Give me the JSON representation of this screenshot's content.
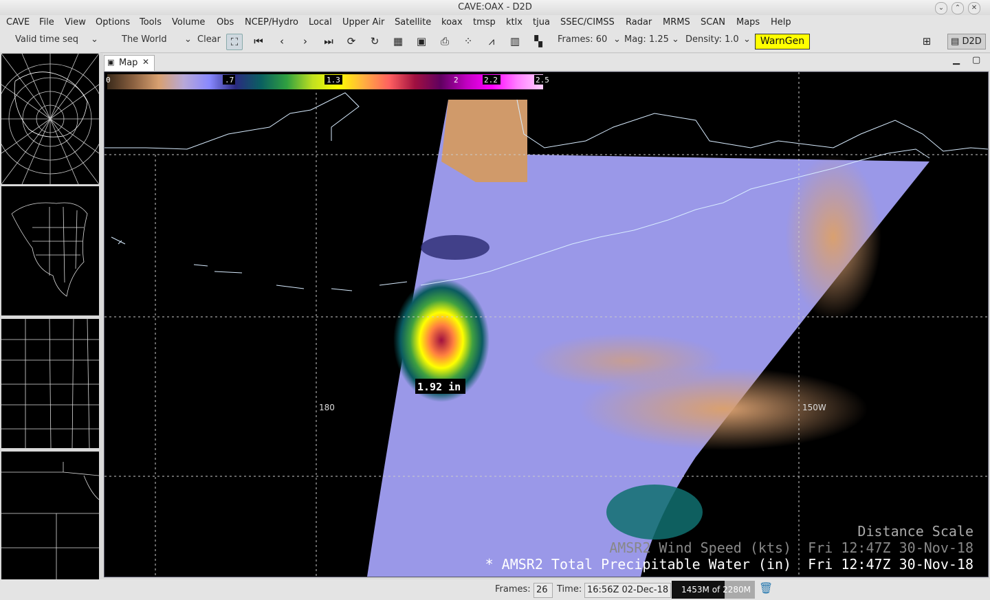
{
  "window": {
    "title": "CAVE:OAX - D2D"
  },
  "menu": [
    "CAVE",
    "File",
    "View",
    "Options",
    "Tools",
    "Volume",
    "Obs",
    "NCEP/Hydro",
    "Local",
    "Upper Air",
    "Satellite",
    "koax",
    "tmsp",
    "ktlx",
    "tjua",
    "SSEC/CIMSS",
    "Radar",
    "MRMS",
    "SCAN",
    "Maps",
    "Help"
  ],
  "toolbar": {
    "time_mode": "Valid time seq",
    "scale": "The World",
    "clear": "Clear",
    "frames": "Frames: 60",
    "mag": "Mag: 1.25",
    "density": "Density: 1.0",
    "warngen": "WarnGen",
    "perspective": "D2D"
  },
  "tab": {
    "label": "Map"
  },
  "colorbar": {
    "ticks": [
      "0",
      ".7",
      "1.3",
      "2",
      "2.2",
      "2.5"
    ],
    "colors": [
      "#3a2a1a",
      "#8a6040",
      "#d8a070",
      "#b8a8d8",
      "#8888ff",
      "#2a2a80",
      "#0a6060",
      "#30a040",
      "#c0e020",
      "#ffff00",
      "#ffb040",
      "#ff6060",
      "#a01040",
      "#600060",
      "#c000c0",
      "#ff00ff",
      "#ff80ff",
      "#ffd0ff"
    ]
  },
  "map": {
    "label_180": "180",
    "label_150w": "150W",
    "value_label": "1.92 in",
    "legend_scale": "Distance Scale",
    "legend_wind": "AMSR2 Wind Speed (kts)  Fri 12:47Z 30-Nov-18",
    "legend_tpw": "* AMSR2 Total Precipitable Water (in)  Fri 12:47Z 30-Nov-18"
  },
  "status": {
    "frames_label": "Frames:",
    "frames_value": "26",
    "time_label": "Time:",
    "time_value": "16:56Z 02-Dec-18",
    "memory": "1453M of 2280M",
    "memory_fraction": 0.64
  }
}
